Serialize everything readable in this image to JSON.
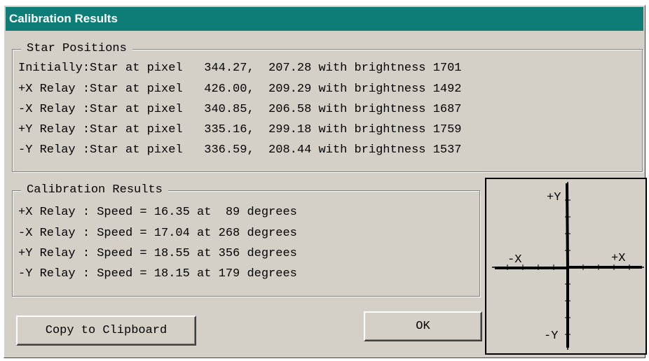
{
  "window": {
    "title": "Calibration Results"
  },
  "star_positions": {
    "legend": "Star Positions",
    "rows": [
      "Initially:Star at pixel   344.27,  207.28 with brightness 1701",
      "+X Relay :Star at pixel   426.00,  209.29 with brightness 1492",
      "-X Relay :Star at pixel   340.85,  206.58 with brightness 1687",
      "+Y Relay :Star at pixel   335.16,  299.18 with brightness 1759",
      "-Y Relay :Star at pixel   336.59,  208.44 with brightness 1537"
    ]
  },
  "calibration_results": {
    "legend": "Calibration Results",
    "rows": [
      "+X Relay : Speed = 16.35 at  89 degrees",
      "-X Relay : Speed = 17.04 at 268 degrees",
      "+Y Relay : Speed = 18.55 at 356 degrees",
      "-Y Relay : Speed = 18.15 at 179 degrees"
    ]
  },
  "buttons": {
    "copy_label": "Copy to Clipboard",
    "ok_label": "OK"
  },
  "axes_diagram": {
    "plus_y": "+Y",
    "minus_y": "-Y",
    "plus_x": "+X",
    "minus_x": "-X"
  },
  "colors": {
    "titlebar": "#0f7d77",
    "face": "#d4d0c8"
  }
}
